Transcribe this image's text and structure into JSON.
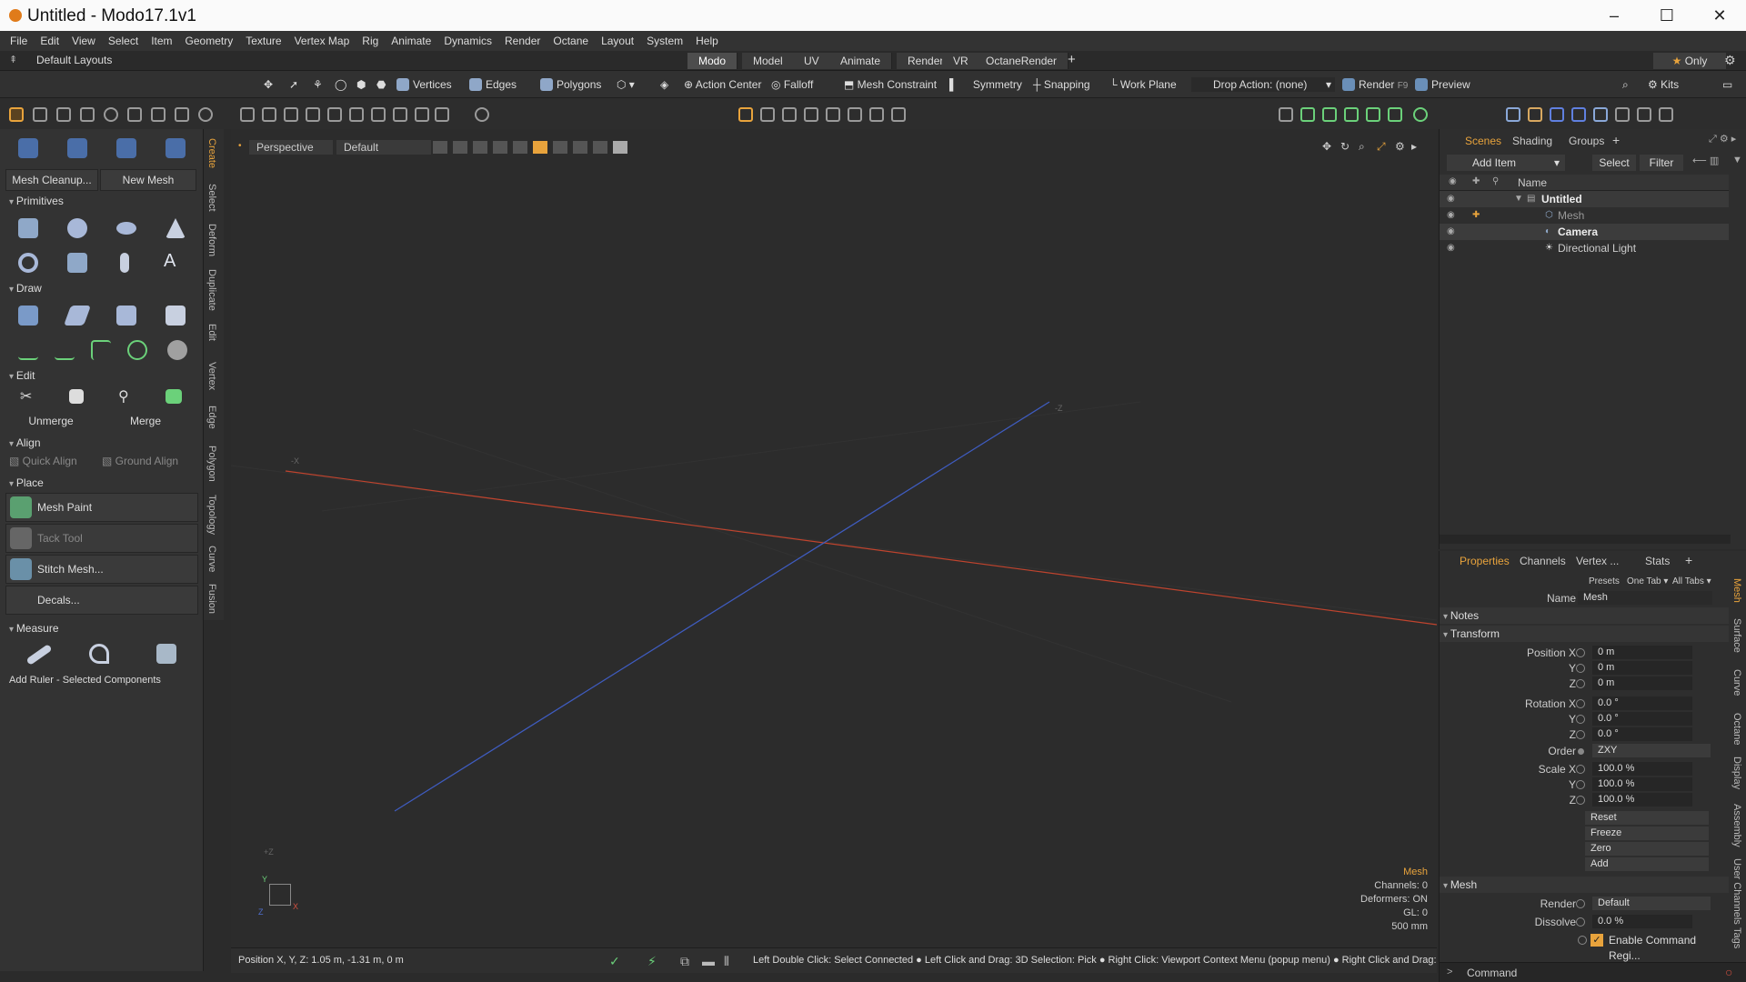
{
  "window": {
    "title": "Untitled - Modo17.1v1",
    "min": "–",
    "max": "☐",
    "close": "✕"
  },
  "menu": [
    "File",
    "Edit",
    "View",
    "Select",
    "Item",
    "Geometry",
    "Texture",
    "Vertex Map",
    "Rig",
    "Animate",
    "Dynamics",
    "Render",
    "Octane",
    "Layout",
    "System",
    "Help"
  ],
  "layout": {
    "label": "Default Layouts",
    "tabs": [
      "Modo",
      "Model",
      "UV",
      "Animate",
      "Render",
      "VR",
      "OctaneRender"
    ],
    "add": "+",
    "only": "Only"
  },
  "toolbar": {
    "vertices": "Vertices",
    "edges": "Edges",
    "polygons": "Polygons",
    "action_center": "Action Center",
    "falloff": "Falloff",
    "mesh_constraint": "Mesh Constraint",
    "symmetry": "Symmetry",
    "snapping": "Snapping",
    "work_plane": "Work Plane",
    "drop_action": "Drop Action: (none)",
    "render": "Render",
    "render_key": "F9",
    "preview": "Preview",
    "kits": "Kits"
  },
  "left": {
    "mesh_cleanup": "Mesh Cleanup...",
    "new_mesh": "New Mesh",
    "primitives": "Primitives",
    "draw": "Draw",
    "edit": "Edit",
    "unmerge": "Unmerge",
    "merge": "Merge",
    "align": "Align",
    "quick_align": "Quick Align",
    "ground_align": "Ground Align",
    "place": "Place",
    "mesh_paint": "Mesh Paint",
    "tack_tool": "Tack Tool",
    "stitch_mesh": "Stitch Mesh...",
    "decals": "Decals...",
    "measure": "Measure",
    "add_ruler": "Add Ruler - Selected Components",
    "vtabs": [
      "Create",
      "Select",
      "Deform",
      "Duplicate",
      "Edit",
      "Vertex",
      "Edge",
      "Polygon",
      "Topology",
      "Curve",
      "Fusion"
    ]
  },
  "viewport": {
    "view": "Perspective",
    "shading": "Default",
    "info": {
      "item": "Mesh",
      "channels": "Channels: 0",
      "deformers": "Deformers: ON",
      "gl": "GL: 0",
      "scale": "500 mm"
    },
    "axis_z_far": "-Z",
    "axis_x_far": "-X",
    "axis_z_near": "+Z",
    "gizmo_y": "Y",
    "gizmo_x": "X",
    "gizmo_z": "Z"
  },
  "status": {
    "position": "Position X, Y, Z:  1.05 m, -1.31 m, 0 m",
    "hint": "Left Double Click: Select Connected ● Left Click and Drag: 3D Selection: Pick ● Right Click: Viewport Context Menu (popup menu) ● Right Click and Drag:"
  },
  "scenes": {
    "tabs": [
      "Scenes",
      "Shading",
      "Groups",
      "+"
    ],
    "add_item": "Add Item",
    "select": "Select",
    "filter": "Filter",
    "col_name": "Name",
    "items": [
      "Untitled",
      "Mesh",
      "Camera",
      "Directional Light"
    ]
  },
  "properties": {
    "tabs": [
      "Properties",
      "Channels",
      "Vertex ...",
      "Stats",
      "+"
    ],
    "presets": "Presets",
    "one_tab": "One Tab ▾",
    "all_tabs": "All Tabs ▾",
    "name_label": "Name",
    "name_value": "Mesh",
    "notes": "Notes",
    "transform": "Transform",
    "pos_label": "Position X",
    "pos": [
      "0 m",
      "0 m",
      "0 m"
    ],
    "rot_label": "Rotation X",
    "rot": [
      "0.0 °",
      "0.0 °",
      "0.0 °"
    ],
    "y": "Y",
    "z": "Z",
    "order_label": "Order",
    "order": "ZXY",
    "scale_label": "Scale X",
    "scale": [
      "100.0 %",
      "100.0 %",
      "100.0 %"
    ],
    "reset": "Reset",
    "freeze": "Freeze",
    "zero": "Zero",
    "add": "Add",
    "mesh_section": "Mesh",
    "render_label": "Render",
    "render_value": "Default",
    "dissolve_label": "Dissolve",
    "dissolve_value": "0.0 %",
    "command_regions": "Enable Command Regi...",
    "command": "Command",
    "vtabs": [
      "Mesh",
      "Surface",
      "Curve",
      "Octane",
      "Display",
      "Assembly",
      "User Channels",
      "Tags"
    ]
  },
  "colors": {
    "accent": "#e8a33c",
    "x_axis": "#c0442e",
    "z_axis": "#3f5cc0"
  }
}
